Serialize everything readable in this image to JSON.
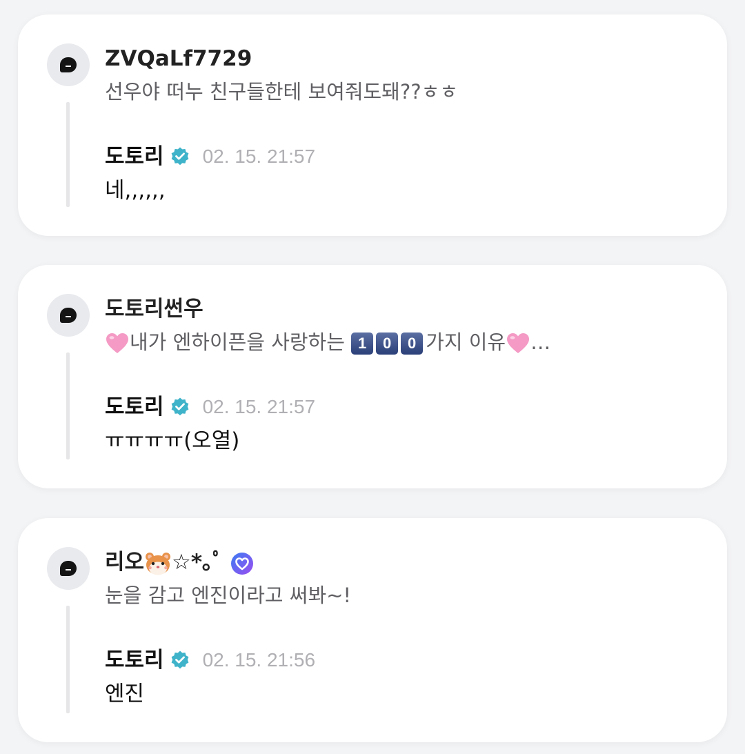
{
  "comments": [
    {
      "author": "ZVQaLf7729",
      "text": "선우야 떠누 친구들한테 보여줘도돼??ㅎㅎ",
      "reply": {
        "author": "도토리",
        "date": "02. 15. 21:57",
        "text": "네,,,,,,"
      }
    },
    {
      "author": "도토리썬우",
      "text_main": "내가 엔하이픈을 사랑하는",
      "keycaps": [
        "1",
        "0",
        "0"
      ],
      "text_tail": "가지 이유",
      "ellipsis": "…",
      "reply": {
        "author": "도토리",
        "date": "02. 15. 21:57",
        "text": "ㅠㅠㅠㅠ(오열)"
      }
    },
    {
      "author": "리오",
      "author_suffix": "☆*｡ﾟ",
      "text": "눈을 감고 엔진이라고 써봐~!",
      "reply": {
        "author": "도토리",
        "date": "02. 15. 21:56",
        "text": "엔진"
      }
    }
  ],
  "colors": {
    "background": "#f3f4f6",
    "card": "#ffffff",
    "verified_badge": "#3fb3c9",
    "muted_text": "#5f5f63",
    "date_text": "#b0b0b4"
  },
  "icons": {
    "avatar": "profile-bubble-icon",
    "verified": "verified-check-icon",
    "heart": "pink-heart-icon",
    "hamster": "hamster-face-icon",
    "membership": "purple-heart-badge-icon"
  }
}
